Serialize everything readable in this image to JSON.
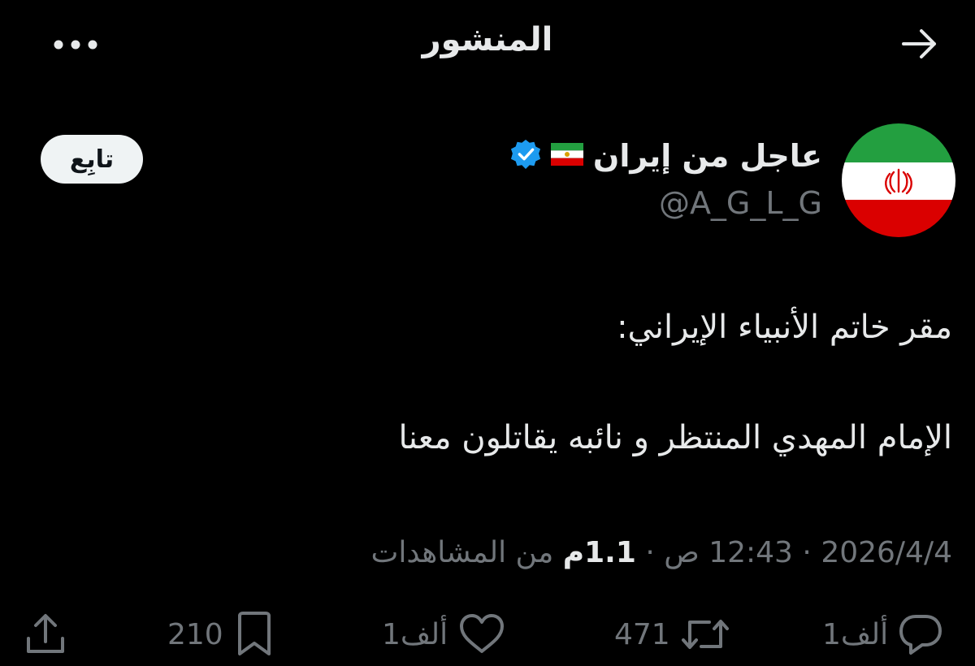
{
  "header": {
    "title": "المنشور",
    "back_icon": "arrow-right-icon",
    "more_icon": "more-horizontal-icon"
  },
  "author": {
    "display_name": "عاجل من إيران",
    "handle": "@A_G_L_G",
    "flag_emoji": "🇮🇷",
    "verified": true,
    "verified_color": "#1d9bf0",
    "follow_label": "تابِع"
  },
  "post": {
    "line1": "مقر خاتم الأنبياء الإيراني:",
    "line2": "الإمام المهدي المنتظر و نائبه يقاتلون معنا"
  },
  "meta": {
    "date": "2026/4/4",
    "time": "12:43 ص",
    "views_count": "1.1م",
    "views_label": "من المشاهدات",
    "separator": "·"
  },
  "actions": {
    "replies": "1ألف",
    "reposts": "471",
    "likes": "1ألف",
    "bookmarks": "210"
  },
  "colors": {
    "background": "#000000",
    "text": "#e7e9ea",
    "muted": "#71767b",
    "flag_green": "#239f40",
    "flag_red": "#da0000"
  }
}
